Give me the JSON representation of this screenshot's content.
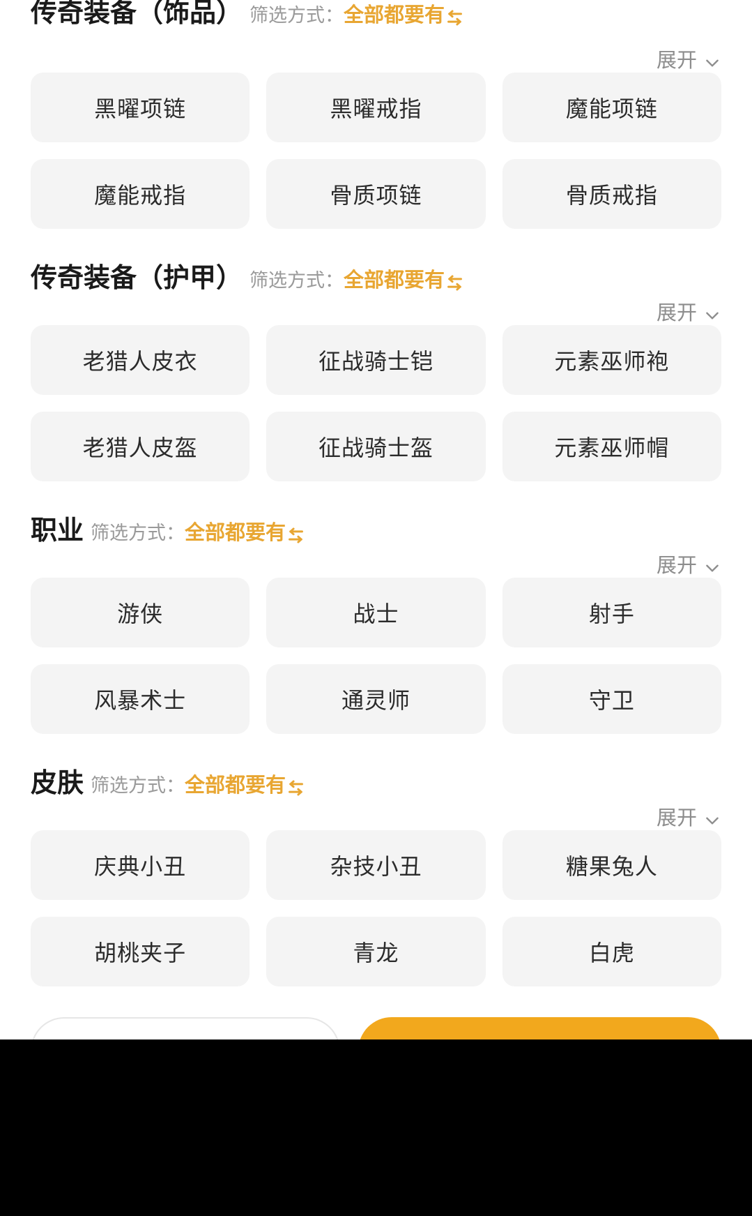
{
  "icons": {
    "swap": "swap-arrows-icon",
    "chevron_down": "chevron-down-icon"
  },
  "colors": {
    "accent": "#e8a632",
    "accent_button": "#f2a81d",
    "chip_bg": "#f4f4f4",
    "title": "#1a1a1a",
    "muted": "#9a9a9a"
  },
  "common": {
    "filter_label": "筛选方式：",
    "filter_value": "全部都要有",
    "expand_label": "展开"
  },
  "sections": [
    {
      "title": "传奇装备（饰品）",
      "filter_label": "筛选方式：",
      "filter_value": "全部都要有",
      "expand_label": "展开",
      "chips": [
        "黑曜项链",
        "黑曜戒指",
        "魔能项链",
        "魔能戒指",
        "骨质项链",
        "骨质戒指"
      ]
    },
    {
      "title": "传奇装备（护甲）",
      "filter_label": "筛选方式：",
      "filter_value": "全部都要有",
      "expand_label": "展开",
      "chips": [
        "老猎人皮衣",
        "征战骑士铠",
        "元素巫师袍",
        "老猎人皮盔",
        "征战骑士盔",
        "元素巫师帽"
      ]
    },
    {
      "title": "职业",
      "filter_label": "筛选方式：",
      "filter_value": "全部都要有",
      "expand_label": "展开",
      "chips": [
        "游侠",
        "战士",
        "射手",
        "风暴术士",
        "通灵师",
        "守卫"
      ]
    },
    {
      "title": "皮肤",
      "filter_label": "筛选方式：",
      "filter_value": "全部都要有",
      "expand_label": "展开",
      "chips": [
        "庆典小丑",
        "杂技小丑",
        "糖果兔人",
        "胡桃夹子",
        "青龙",
        "白虎"
      ]
    }
  ],
  "bottom_bar": {
    "action_label": ""
  }
}
